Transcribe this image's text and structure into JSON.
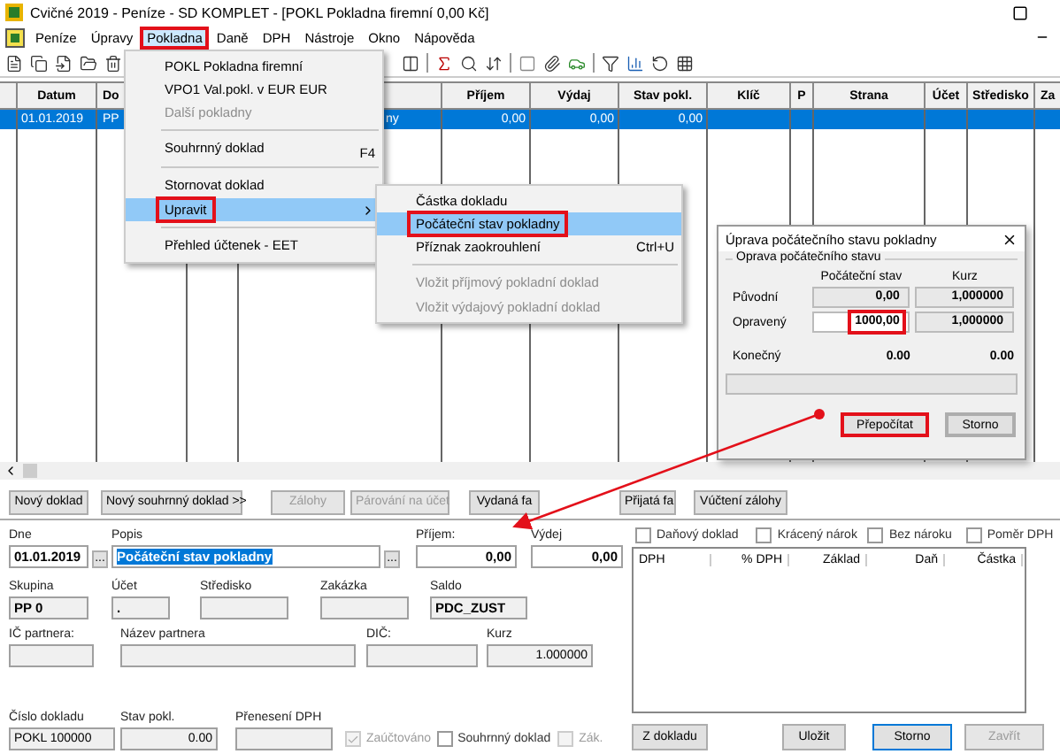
{
  "window": {
    "title": "Cvičné 2019 - Peníze - SD KOMPLET - [POKL Pokladna firemní  0,00 Kč]"
  },
  "menu_bar": [
    {
      "label": "Peníze",
      "selected": false,
      "marked": false
    },
    {
      "label": "Úpravy",
      "selected": false,
      "marked": false
    },
    {
      "label": "Pokladna",
      "selected": true,
      "marked": true
    },
    {
      "label": "Daně",
      "selected": false,
      "marked": false
    },
    {
      "label": "DPH",
      "selected": false,
      "marked": false
    },
    {
      "label": "Nástroje",
      "selected": false,
      "marked": false
    },
    {
      "label": "Okno",
      "selected": false,
      "marked": false
    },
    {
      "label": "Nápověda",
      "selected": false,
      "marked": false
    }
  ],
  "table": {
    "columns": {
      "datum": "Datum",
      "doklad": "Do",
      "prijem": "Příjem",
      "vydaj": "Výdaj",
      "stav_pokl": "Stav pokl.",
      "klic": "Klíč",
      "p": "P",
      "strana": "Strana",
      "ucet": "Účet",
      "stredisko": "Středisko",
      "za": "Za"
    },
    "rows": [
      {
        "selected": true,
        "datum": "01.01.2019",
        "doklad": "PP",
        "column_5": "ny",
        "prijem": "0,00",
        "vydaj": "0,00",
        "stav_pokl": "0,00"
      }
    ]
  },
  "buttons": [
    {
      "label": "Nový doklad",
      "disabled": false
    },
    {
      "label": "Nový souhrnný doklad >>",
      "disabled": false
    },
    {
      "label": "Zálohy",
      "disabled": true
    },
    {
      "label": "Párování na účet",
      "disabled": true
    },
    {
      "label": "Vydaná fa",
      "disabled": false
    },
    {
      "label": "Přijatá fa",
      "disabled": false
    },
    {
      "label": "Vúčtení zálohy",
      "disabled": false
    }
  ],
  "form": {
    "rows": [
      [
        {
          "label": "Dne",
          "value": "01.01.2019",
          "kind": "text",
          "editable": true,
          "text_selected": false,
          "picker": "..."
        },
        {
          "label": "Popis",
          "value": "Počáteční stav pokladny",
          "kind": "text",
          "editable": true,
          "text_selected": true,
          "picker": "..."
        },
        {
          "label": "Příjem:",
          "value": "0,00",
          "kind": "number",
          "editable": true,
          "text_selected": false
        },
        {
          "label": "Výdej",
          "value": "0,00",
          "kind": "number",
          "editable": true,
          "text_selected": false
        }
      ],
      [
        {
          "label": "Skupina",
          "value": "PP      0",
          "kind": "text",
          "editable": false
        },
        {
          "label": "Účet",
          "value": ".",
          "kind": "text",
          "editable": false
        },
        {
          "label": "Středisko",
          "kind": "text",
          "editable": false
        },
        {
          "label": "Zakázka",
          "kind": "text",
          "editable": false
        },
        {
          "label": "Saldo",
          "value": "PDC_ZUST",
          "kind": "text",
          "editable": false
        }
      ],
      [
        {
          "label": "IČ partnera:",
          "kind": "text",
          "editable": false
        },
        {
          "label": "Název partnera",
          "kind": "text",
          "editable": false
        },
        {
          "label": "DIČ:",
          "kind": "text",
          "editable": false
        },
        {
          "label": "Kurz",
          "value": "1.000000",
          "kind": "number",
          "editable": false
        }
      ],
      [
        {
          "label": "Číslo dokladu",
          "value": "POKL 100000",
          "kind": "text",
          "editable": false
        },
        {
          "label": "Stav pokl.",
          "value": "0.00",
          "kind": "number",
          "editable": false
        },
        {
          "label": "Přenesení DPH",
          "kind": "text",
          "editable": false
        },
        {
          "label": "Zaúčtováno",
          "kind": "checkbox",
          "checked": true,
          "disabled": true
        },
        {
          "label": "Souhrnný doklad",
          "kind": "checkbox",
          "checked": false,
          "disabled": false
        },
        {
          "label": "Zák.",
          "kind": "checkbox",
          "checked": false,
          "disabled": true
        }
      ]
    ]
  },
  "checkboxes": [
    {
      "label": "Daňový doklad",
      "checked": false
    },
    {
      "label": "Krácený nárok",
      "checked": false
    },
    {
      "label": "Bez nároku",
      "checked": false
    },
    {
      "label": "Poměr DPH",
      "checked": false
    }
  ],
  "vat_table": {
    "columns": [
      "DPH",
      "% DPH",
      "Základ",
      "Daň",
      "Částka"
    ]
  },
  "side_buttons": [
    {
      "label": "Z dokladu",
      "disabled": false,
      "focused": false
    },
    {
      "label": "Uložit",
      "disabled": false,
      "focused": false
    },
    {
      "label": "Storno",
      "disabled": false,
      "focused": true
    },
    {
      "label": "Zavřít",
      "disabled": true,
      "focused": false
    }
  ],
  "pokladna_menu": [
    {
      "label": "POKL Pokladna firemní",
      "disabled": false,
      "selected": false,
      "marked": false
    },
    {
      "label": "VPO1 Val.pokl. v EUR EUR",
      "disabled": false,
      "selected": false,
      "marked": false
    },
    {
      "label": "Další pokladny",
      "disabled": true,
      "selected": false,
      "marked": false
    },
    {
      "label": "Souhrnný doklad",
      "shortcut": "F4",
      "separator_before": true,
      "disabled": false,
      "selected": false,
      "marked": false
    },
    {
      "label": "Stornovat doklad",
      "separator_before": true,
      "disabled": false,
      "selected": false,
      "marked": false
    },
    {
      "label": "Upravit",
      "submenu": true,
      "disabled": false,
      "selected": true,
      "marked": true
    },
    {
      "label": "Přehled účtenek - EET",
      "separator_before": true,
      "disabled": false,
      "selected": false,
      "marked": false
    }
  ],
  "upravit_submenu": [
    {
      "label": "Částka dokladu",
      "disabled": false,
      "selected": false,
      "marked": false
    },
    {
      "label": "Počáteční stav pokladny",
      "disabled": false,
      "selected": true,
      "marked": true
    },
    {
      "label": "Příznak zaokrouhlení",
      "shortcut": "Ctrl+U",
      "disabled": false,
      "selected": false,
      "marked": false
    },
    {
      "label": "Vložit příjmový pokladní doklad",
      "separator_before": true,
      "disabled": true,
      "selected": false,
      "marked": false
    },
    {
      "label": "Vložit výdajový pokladní doklad",
      "disabled": true,
      "selected": false,
      "marked": false
    }
  ],
  "dialog": {
    "title": "Úprava počátečního stavu pokladny",
    "group_title": "Oprava počátečního stavu",
    "column_headers": [
      "Počáteční stav",
      "Kurz"
    ],
    "rows": [
      {
        "label": "Původní",
        "value": "0,00",
        "rate": "1,000000",
        "editable": false,
        "marked": false
      },
      {
        "label": "Opravený",
        "value": "1000,00",
        "rate": "1,000000",
        "editable": true,
        "marked": true
      }
    ],
    "total": {
      "label": "Konečný",
      "value": "0.00",
      "rate": "0.00"
    },
    "progress": {
      "level": 0
    },
    "buttons": [
      {
        "label": "Přepočítat",
        "marked": true
      },
      {
        "label": "Storno",
        "marked": false
      }
    ]
  }
}
